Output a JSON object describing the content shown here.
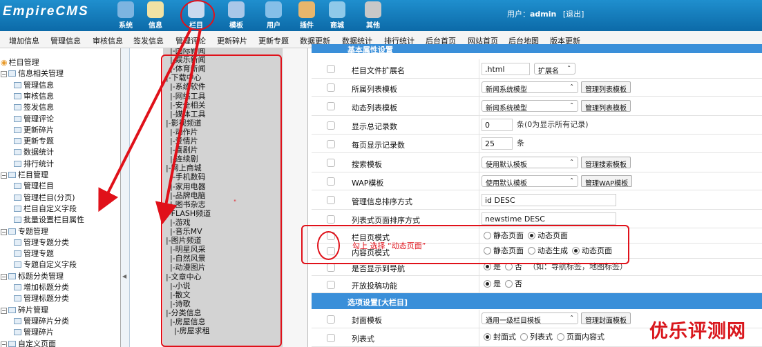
{
  "header": {
    "logo": "EmpireCMS",
    "nav": [
      {
        "label": "系统",
        "icon": "globe-icon",
        "color": "#7db4e0"
      },
      {
        "label": "信息",
        "icon": "notepad-icon",
        "color": "#f1e2a4"
      },
      {
        "label": "栏目",
        "icon": "window-icon",
        "color": "#c9d9ee"
      },
      {
        "label": "模板",
        "icon": "template-icon",
        "color": "#a9c7e8"
      },
      {
        "label": "用户",
        "icon": "user-icon",
        "color": "#85bfe8"
      },
      {
        "label": "插件",
        "icon": "tools-icon",
        "color": "#e8b66c"
      },
      {
        "label": "商城",
        "icon": "shop-icon",
        "color": "#8fc9e9"
      },
      {
        "label": "其他",
        "icon": "gear-icon",
        "color": "#c8c8c8"
      }
    ],
    "user_label": "用户：",
    "username": "admin",
    "logout": "[退出]"
  },
  "menubar": [
    "增加信息",
    "管理信息",
    "审核信息",
    "签发信息",
    "管理评论",
    "更新碎片",
    "更新专题",
    "数据更新",
    "数据统计",
    "排行统计",
    "后台首页",
    "网站首页",
    "后台地图",
    "版本更新"
  ],
  "tree": [
    {
      "label": "栏目管理",
      "depth": 0,
      "kind": "root"
    },
    {
      "label": "信息相关管理",
      "depth": 0,
      "kind": "folder"
    },
    {
      "label": "管理信息",
      "depth": 1,
      "kind": "leaf"
    },
    {
      "label": "审核信息",
      "depth": 1,
      "kind": "leaf"
    },
    {
      "label": "签发信息",
      "depth": 1,
      "kind": "leaf"
    },
    {
      "label": "管理评论",
      "depth": 1,
      "kind": "leaf"
    },
    {
      "label": "更新碎片",
      "depth": 1,
      "kind": "leaf"
    },
    {
      "label": "更新专题",
      "depth": 1,
      "kind": "leaf"
    },
    {
      "label": "数据统计",
      "depth": 1,
      "kind": "leaf"
    },
    {
      "label": "排行统计",
      "depth": 1,
      "kind": "leaf"
    },
    {
      "label": "栏目管理",
      "depth": 0,
      "kind": "folder"
    },
    {
      "label": "管理栏目",
      "depth": 1,
      "kind": "leaf"
    },
    {
      "label": "管理栏目(分页)",
      "depth": 1,
      "kind": "leaf"
    },
    {
      "label": "栏目自定义字段",
      "depth": 1,
      "kind": "leaf"
    },
    {
      "label": "批量设置栏目属性",
      "depth": 1,
      "kind": "leaf"
    },
    {
      "label": "专题管理",
      "depth": 0,
      "kind": "folder"
    },
    {
      "label": "管理专题分类",
      "depth": 1,
      "kind": "leaf"
    },
    {
      "label": "管理专题",
      "depth": 1,
      "kind": "leaf"
    },
    {
      "label": "专题自定义字段",
      "depth": 1,
      "kind": "leaf"
    },
    {
      "label": "标题分类管理",
      "depth": 0,
      "kind": "folder"
    },
    {
      "label": "增加标题分类",
      "depth": 1,
      "kind": "leaf"
    },
    {
      "label": "管理标题分类",
      "depth": 1,
      "kind": "leaf"
    },
    {
      "label": "碎片管理",
      "depth": 0,
      "kind": "folder"
    },
    {
      "label": "管理碎片分类",
      "depth": 1,
      "kind": "leaf"
    },
    {
      "label": "管理碎片",
      "depth": 1,
      "kind": "leaf"
    },
    {
      "label": "自定义页面",
      "depth": 0,
      "kind": "folder"
    }
  ],
  "columns": [
    "|-国际新闻",
    "|-娱乐新闻",
    "|-体育新闻",
    "|-下载中心",
    "|-系统软件",
    "|-网络工具",
    "|-安全相关",
    "|-媒体工具",
    "|-影视频道",
    "|-动作片",
    "|-爱情片",
    "|-喜剧片",
    "|-连续剧",
    "|-网上商城",
    "|-手机数码",
    "|-家用电器",
    "|-品牌电脑",
    "|-图书杂志",
    "|-FLASH频道",
    "|-游戏",
    "|-音乐MV",
    "|-图片频道",
    "|-明星风采",
    "|-自然风景",
    "|-动漫图片",
    "|-文章中心",
    "|-小说",
    "|-散文",
    "|-诗歌",
    "|-分类信息",
    "|-房屋信息",
    "|-房屋求租"
  ],
  "columns_depth": [
    1,
    1,
    1,
    0,
    1,
    1,
    1,
    1,
    0,
    1,
    1,
    1,
    1,
    0,
    1,
    1,
    1,
    1,
    0,
    1,
    1,
    0,
    1,
    1,
    1,
    0,
    1,
    1,
    1,
    0,
    1,
    2
  ],
  "form": {
    "top_cut_header": "基本属性设置",
    "rows": [
      {
        "label": "栏目文件扩展名",
        "input": ".html",
        "select": "扩展名"
      },
      {
        "label": "所属列表模板",
        "select": "新闻系统模型",
        "button": "管理列表模板"
      },
      {
        "label": "动态列表模板",
        "select": "新闻系统模型",
        "button": "管理列表模板"
      },
      {
        "label": "显示总记录数",
        "input": "0",
        "suffix": "条(0为显示所有记录)"
      },
      {
        "label": "每页显示记录数",
        "input": "25",
        "suffix": "条"
      },
      {
        "label": "搜索模板",
        "select": "使用默认模板",
        "button": "管理搜索模板"
      },
      {
        "label": "WAP模板",
        "select": "使用默认模板",
        "button": "管理WAP模板"
      },
      {
        "label": "管理信息排序方式",
        "input": "id DESC"
      },
      {
        "label": "列表式页面排序方式",
        "input": "newstime DESC"
      },
      {
        "label": "栏目页模式",
        "radios": [
          "静态页面",
          "动态页面"
        ],
        "selected": 1
      },
      {
        "label": "内容页模式",
        "radios": [
          "静态页面",
          "动态生成",
          "动态页面"
        ],
        "selected": 2
      },
      {
        "label": "是否显示到导航",
        "radios": [
          "是",
          "否"
        ],
        "selected": 0,
        "suffix": "（如：导航标签，地图标签）"
      },
      {
        "label": "开放投稿功能",
        "radios": [
          "是",
          "否"
        ],
        "selected": 0
      }
    ],
    "section2": "选项设置[大栏目]",
    "rows2": [
      {
        "label": "封面模板",
        "select": "通用一级栏目模板",
        "button": "管理封面模板"
      },
      {
        "label": "列表式",
        "radios": [
          "封面式",
          "列表式",
          "页面内容式"
        ],
        "selected": 0
      }
    ]
  },
  "annotation_text": "勾上 选择 “动态页面”",
  "stray_mark": "\"",
  "watermark": "优乐评测网",
  "colors": {
    "topbar": "#1a84c5",
    "accent": "#3a8fd9",
    "annotation": "#e0111a"
  }
}
